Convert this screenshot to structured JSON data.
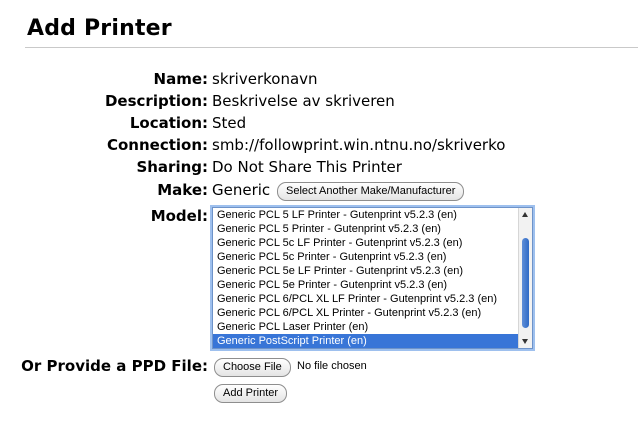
{
  "page": {
    "title": "Add Printer"
  },
  "fields": {
    "name": {
      "label": "Name:",
      "value": "skriverkonavn"
    },
    "description": {
      "label": "Description:",
      "value": "Beskrivelse av skriveren"
    },
    "location": {
      "label": "Location:",
      "value": "Sted"
    },
    "connection": {
      "label": "Connection:",
      "value": "smb://followprint.win.ntnu.no/skriverko"
    },
    "sharing": {
      "label": "Sharing:",
      "value": "Do Not Share This Printer"
    },
    "make": {
      "label": "Make:",
      "value": "Generic",
      "button_label": "Select Another Make/Manufacturer"
    },
    "model": {
      "label": "Model:",
      "options": [
        "Generic PCL 5 LF Printer - Gutenprint v5.2.3 (en)",
        "Generic PCL 5 Printer - Gutenprint v5.2.3 (en)",
        "Generic PCL 5c LF Printer - Gutenprint v5.2.3 (en)",
        "Generic PCL 5c Printer - Gutenprint v5.2.3 (en)",
        "Generic PCL 5e LF Printer - Gutenprint v5.2.3 (en)",
        "Generic PCL 5e Printer - Gutenprint v5.2.3 (en)",
        "Generic PCL 6/PCL XL LF Printer - Gutenprint v5.2.3 (en)",
        "Generic PCL 6/PCL XL Printer - Gutenprint v5.2.3 (en)",
        "Generic PCL Laser Printer (en)",
        "Generic PostScript Printer (en)"
      ],
      "selected_index": 9
    },
    "ppd": {
      "label": "Or Provide a PPD File:",
      "button_label": "Choose File",
      "status": "No file chosen"
    }
  },
  "submit": {
    "label": "Add Printer"
  },
  "colors": {
    "selection": "#3875d7",
    "focus_ring": "#9ec0ee"
  }
}
